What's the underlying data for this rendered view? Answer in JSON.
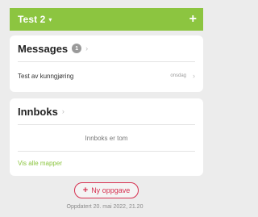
{
  "header": {
    "title": "Test 2",
    "caret": "▾",
    "add": "+"
  },
  "messages": {
    "title": "Messages",
    "badge": "1",
    "chevron": "›",
    "items": [
      {
        "text": "Test av kunngjøring",
        "time": "onsdag",
        "chevron": "›"
      }
    ]
  },
  "innboks": {
    "title": "Innboks",
    "chevron": "›",
    "empty_text": "Innboks er tom",
    "show_all": "Vis alle mapper"
  },
  "new_task": {
    "plus": "+",
    "label": "Ny oppgave"
  },
  "footer": {
    "updated": "Oppdatert 20. mai 2022, 21.20"
  },
  "colors": {
    "accent_green": "#8cc540",
    "accent_red": "#d62f4f",
    "background": "#ececec"
  },
  "icons": [
    "caret-down-icon",
    "plus-icon",
    "chevron-right-icon"
  ]
}
